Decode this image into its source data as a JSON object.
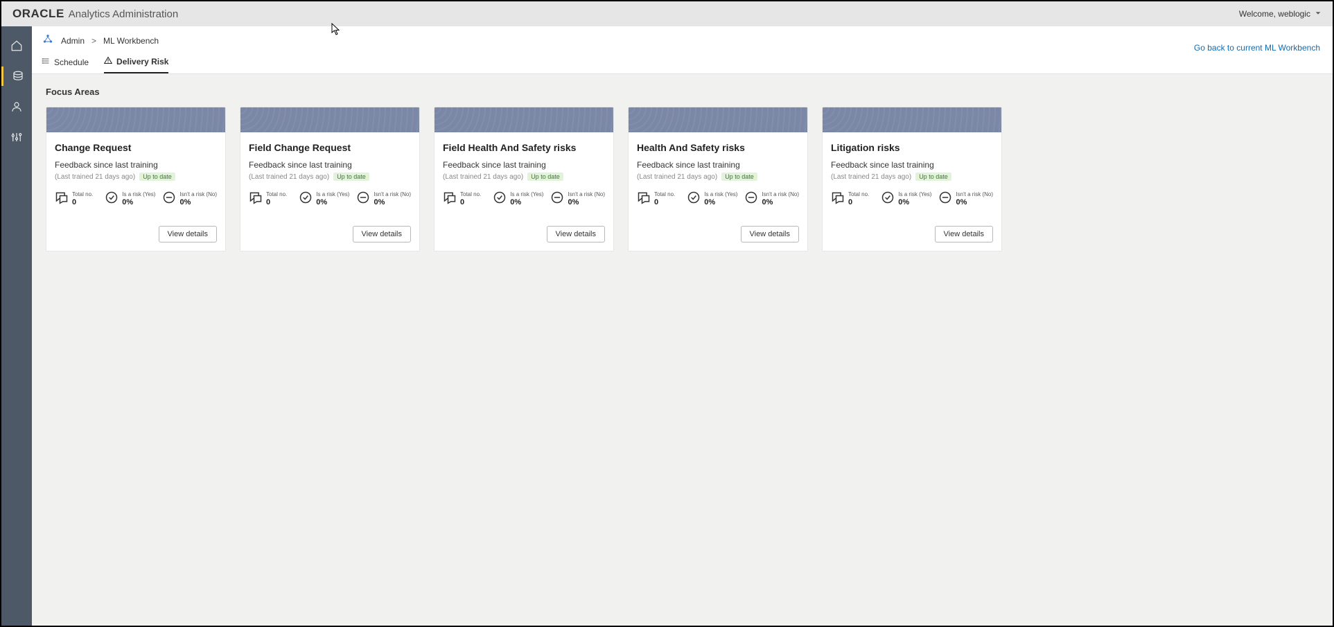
{
  "header": {
    "brand_logo": "ORACLE",
    "brand_sub": "Analytics Administration",
    "welcome": "Welcome, weblogic"
  },
  "breadcrumb": {
    "item1": "Admin",
    "sep": ">",
    "item2": "ML Workbench"
  },
  "tabs": {
    "schedule": "Schedule",
    "delivery_risk": "Delivery Risk"
  },
  "backlink": "Go back to current ML Workbench",
  "section_title": "Focus Areas",
  "common": {
    "feedback_label": "Feedback since last training",
    "trained_label": "(Last trained 21 days ago)",
    "badge": "Up to date",
    "total_label": "Total no.",
    "yes_label": "Is a risk (Yes)",
    "no_label": "Isn't a risk (No)",
    "view_details": "View details"
  },
  "cards": [
    {
      "title": "Change Request",
      "total": "0",
      "yes": "0%",
      "no": "0%"
    },
    {
      "title": "Field Change Request",
      "total": "0",
      "yes": "0%",
      "no": "0%"
    },
    {
      "title": "Field Health And Safety risks",
      "total": "0",
      "yes": "0%",
      "no": "0%"
    },
    {
      "title": "Health And Safety risks",
      "total": "0",
      "yes": "0%",
      "no": "0%"
    },
    {
      "title": "Litigation risks",
      "total": "0",
      "yes": "0%",
      "no": "0%"
    }
  ]
}
